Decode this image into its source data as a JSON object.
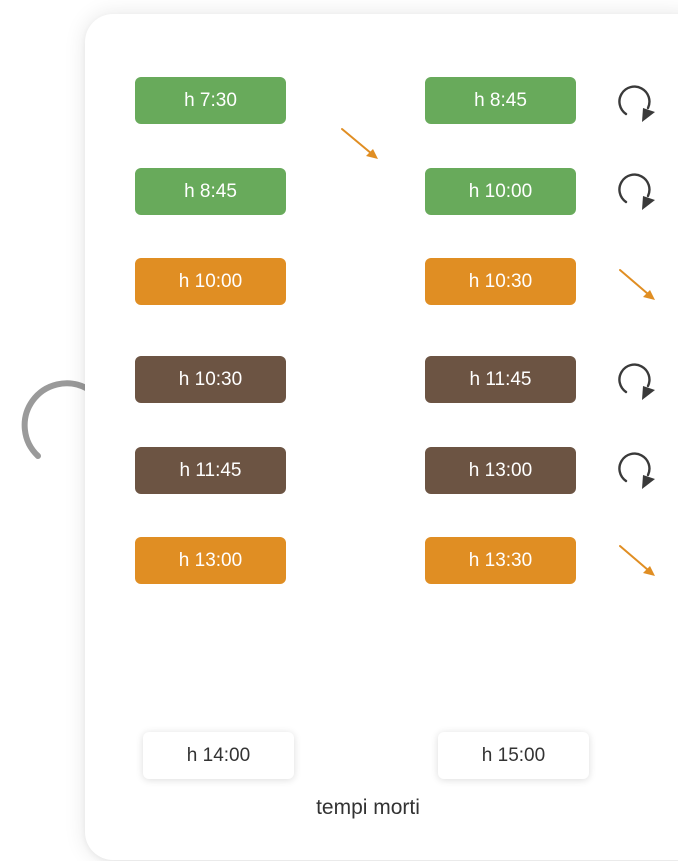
{
  "rows": [
    {
      "start": "h 7:30",
      "end": "h 8:45",
      "color": "#68aa5b",
      "status_icon": "refresh-icon"
    },
    {
      "start": "h 8:45",
      "end": "h 10:00",
      "color": "#68aa5b",
      "status_icon": "refresh-icon"
    },
    {
      "start": "h 10:00",
      "end": "h 10:30",
      "color": "#e08e23",
      "status_icon": "arrow-down-right-icon"
    },
    {
      "start": "h 10:30",
      "end": "h 11:45",
      "color": "#6c5443",
      "status_icon": "refresh-icon"
    },
    {
      "start": "h 11:45",
      "end": "h 13:00",
      "color": "#6c5443",
      "status_icon": "refresh-icon"
    },
    {
      "start": "h 13:00",
      "end": "h 13:30",
      "color": "#e08e23",
      "status_icon": "arrow-down-right-icon"
    }
  ],
  "idle": {
    "start": "h 14:00",
    "end": "h 15:00",
    "label": "tempi morti"
  },
  "colors": {
    "green": "#68aa5b",
    "orange": "#e08e23",
    "brown": "#6c5443",
    "icon_dark": "#3a3a3a",
    "loop_gray": "#9a9a9a"
  }
}
